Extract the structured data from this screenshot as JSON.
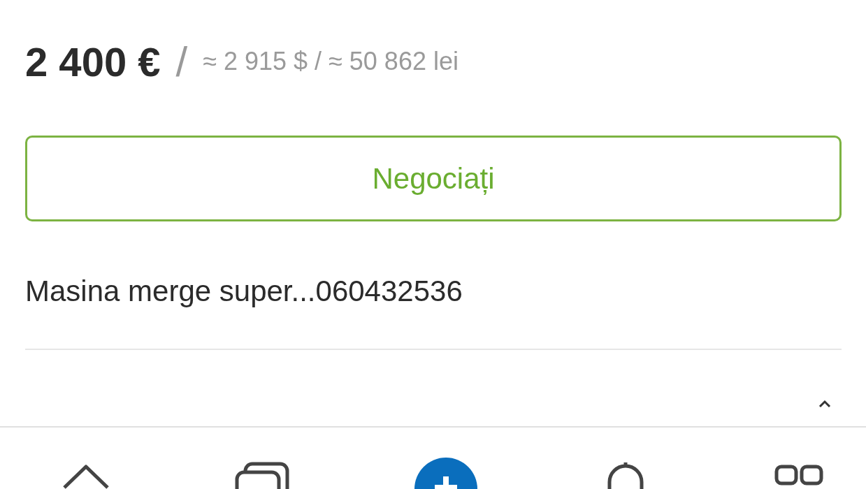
{
  "price": {
    "main": "2 400 €",
    "separator": "/",
    "conversions": "≈ 2 915 $ / ≈ 50 862 lei"
  },
  "negotiate_button": {
    "label": "Negociați"
  },
  "description": "Masina merge super...060432536",
  "bottom_nav": [
    {
      "kind": "home"
    },
    {
      "kind": "cards"
    },
    {
      "kind": "add"
    },
    {
      "kind": "bell"
    },
    {
      "kind": "grid"
    }
  ]
}
